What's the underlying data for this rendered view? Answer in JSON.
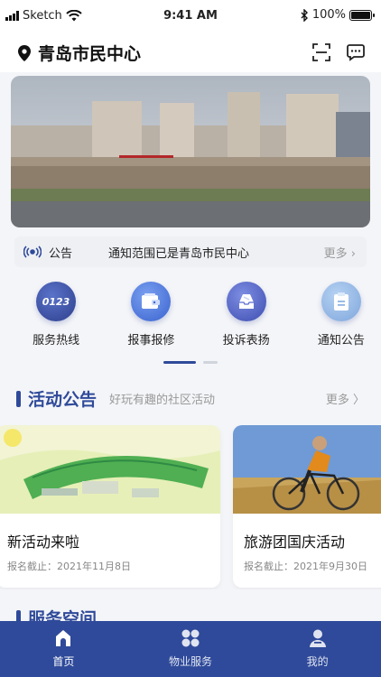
{
  "status_bar": {
    "carrier": "Sketch",
    "time": "9:41 AM",
    "battery": "100%"
  },
  "header": {
    "location": "青岛市民中心"
  },
  "notice": {
    "tag": "公告",
    "text": "通知范围已是青岛市民中心",
    "more": "更多 ›"
  },
  "quick_actions": [
    {
      "label": "服务热线",
      "icon": "phone-number-icon",
      "color": "#3a4fa3"
    },
    {
      "label": "报事报修",
      "icon": "wallet-icon",
      "color": "#4a74d8"
    },
    {
      "label": "投诉表扬",
      "icon": "inbox-icon",
      "color": "#5064c8"
    },
    {
      "label": "通知公告",
      "icon": "clipboard-icon",
      "color": "#8fb5e3"
    }
  ],
  "activity_section": {
    "title": "活动公告",
    "subtitle": "好玩有趣的社区活动",
    "more": "更多 〉"
  },
  "activity_cards": [
    {
      "title": "新活动来啦",
      "date": "报名截止：2021年11月8日"
    },
    {
      "title": "旅游团国庆活动",
      "date": "报名截止：2021年9月30日"
    }
  ],
  "service_section": {
    "title": "服务空间"
  },
  "tabs": [
    {
      "label": "首页",
      "icon": "home-icon",
      "active": true
    },
    {
      "label": "物业服务",
      "icon": "grid-icon",
      "active": false
    },
    {
      "label": "我的",
      "icon": "user-icon",
      "active": false
    }
  ],
  "colors": {
    "primary": "#2f4a9a",
    "background": "#f4f5f8"
  }
}
